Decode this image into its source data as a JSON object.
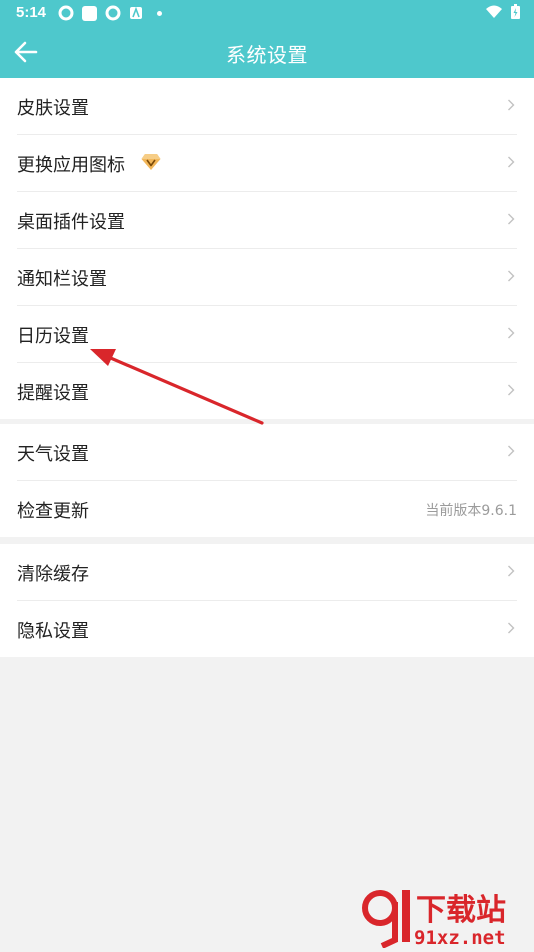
{
  "status_bar": {
    "time": "5:14"
  },
  "header": {
    "title": "系统设置"
  },
  "groups": [
    {
      "rows": [
        {
          "label": "皮肤设置"
        },
        {
          "label": "更换应用图标"
        },
        {
          "label": "桌面插件设置"
        },
        {
          "label": "通知栏设置"
        },
        {
          "label": "日历设置"
        },
        {
          "label": "提醒设置"
        }
      ]
    },
    {
      "rows": [
        {
          "label": "天气设置"
        },
        {
          "label": "检查更新",
          "value": "当前版本9.6.1"
        }
      ]
    },
    {
      "rows": [
        {
          "label": "清除缓存"
        },
        {
          "label": "隐私设置"
        }
      ]
    }
  ],
  "icons": {
    "back": "arrow-left-icon",
    "chevron": "chevron-right-icon",
    "vip": "diamond-icon"
  },
  "colors": {
    "header_bg": "#4ec8cc",
    "page_bg": "#f2f2f2",
    "annotation_arrow": "#d9262b"
  },
  "watermark": {
    "brand": "下载站",
    "domain": "91xz.net"
  }
}
